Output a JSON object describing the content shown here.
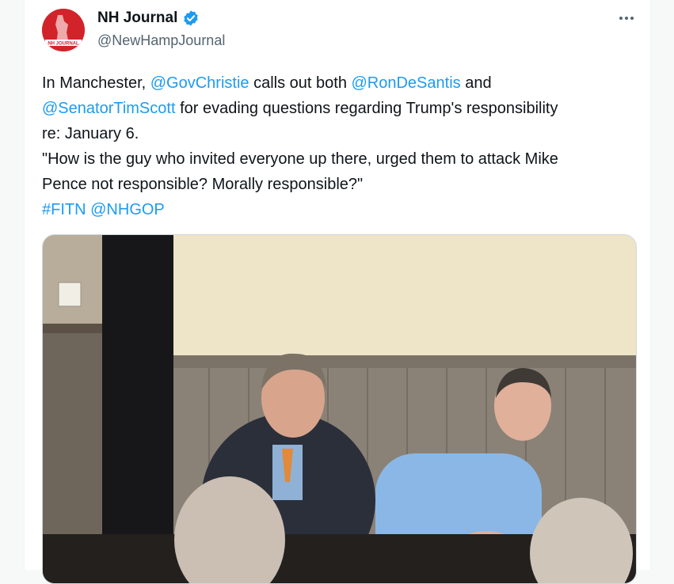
{
  "account": {
    "display_name": "NH Journal",
    "handle": "@NewHampJournal",
    "avatar_text": "JOURNAL",
    "brand_color": "#d2232a",
    "verified_color": "#1d9bf0"
  },
  "tweet": {
    "lines": [
      [
        {
          "t": "In Manchester, "
        },
        {
          "t": "@GovChristie",
          "m": 1
        },
        {
          "t": " calls out both "
        },
        {
          "t": "@RonDeSantis",
          "m": 1
        },
        {
          "t": " and"
        }
      ],
      [
        {
          "t": "@SenatorTimScott",
          "m": 1
        },
        {
          "t": " for evading questions regarding Trump's responsibility"
        }
      ],
      [
        {
          "t": "re: January 6."
        }
      ],
      [
        {
          "t": "\"How is the guy who invited everyone up there, urged them to attack Mike"
        }
      ],
      [
        {
          "t": "Pence not responsible? Morally responsible?\""
        }
      ],
      [
        {
          "t": "#FITN",
          "m": 1
        },
        {
          "t": " "
        },
        {
          "t": "@NHGOP",
          "m": 1
        }
      ]
    ]
  },
  "colors": {
    "link": "#1d9bf0",
    "text": "#0f1419",
    "secondary": "#536471"
  }
}
